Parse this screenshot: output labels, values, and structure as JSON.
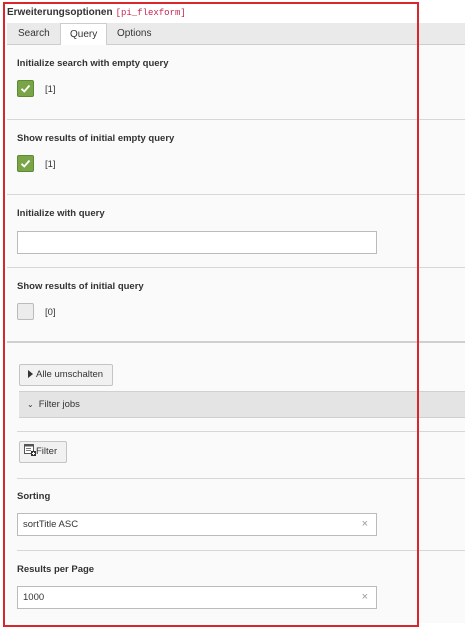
{
  "panel": {
    "title": "Erweiterungsoptionen",
    "code": "[pi_flexform]"
  },
  "tabs": [
    {
      "label": "Search",
      "active": false
    },
    {
      "label": "Query",
      "active": true
    },
    {
      "label": "Options",
      "active": false
    }
  ],
  "fields": {
    "init_empty": {
      "label": "Initialize search with empty query",
      "checked": true,
      "value": "[1]"
    },
    "show_initial_empty": {
      "label": "Show results of initial empty query",
      "checked": true,
      "value": "[1]"
    },
    "init_with_query": {
      "label": "Initialize with query",
      "value": ""
    },
    "show_initial_query": {
      "label": "Show results of initial query",
      "checked": false,
      "value": "[0]"
    },
    "sorting": {
      "label": "Sorting",
      "value": "sortTitle ASC",
      "clear": "×"
    },
    "results_per_page": {
      "label": "Results per Page",
      "value": "1000",
      "clear": "×"
    }
  },
  "buttons": {
    "toggle_all": "Alle umschalten",
    "filter_jobs": "Filter jobs",
    "filter": "Filter"
  },
  "colors": {
    "accent_red": "#d9262b",
    "checkbox_green": "#79a548"
  }
}
